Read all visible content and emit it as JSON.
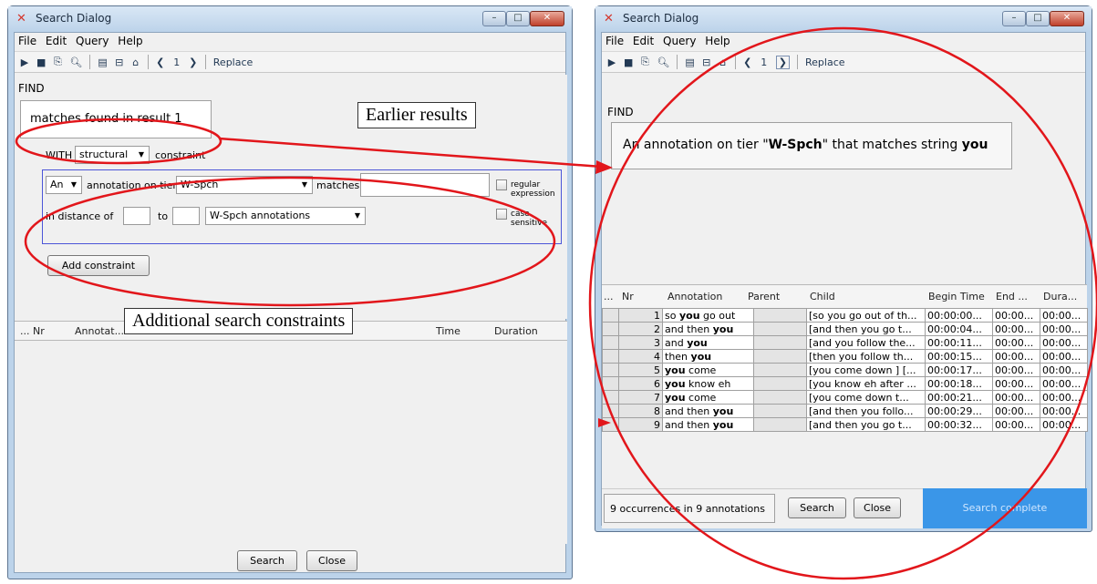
{
  "left_window": {
    "title": "Search Dialog",
    "menu": [
      "File",
      "Edit",
      "Query",
      "Help"
    ],
    "toolbar": {
      "page_indicator": "1",
      "replace_label": "Replace"
    },
    "find_label": "FIND",
    "result_ref_text": "matches found in result 1",
    "with_label": "WITH",
    "constraint_type": "structural",
    "constraint_suffix": "constraint",
    "quantifier": "An",
    "annotation_on_tier": "annotation on tier",
    "tier": "W-Spch",
    "matches_label": "matches",
    "regex_label": "regular expression",
    "in_distance_label": "in distance of",
    "to_label": "to",
    "unit": "W-Spch annotations",
    "case_label": "case sensitive",
    "add_constraint": "Add constraint",
    "columns": [
      "... Nr",
      "Annotat...",
      "Time",
      "Duration"
    ],
    "search_button": "Search",
    "close_button": "Close"
  },
  "right_window": {
    "title": "Search Dialog",
    "menu": [
      "File",
      "Edit",
      "Query",
      "Help"
    ],
    "toolbar": {
      "page_indicator": "1",
      "replace_label": "Replace"
    },
    "find_label": "FIND",
    "query": {
      "prefix": "An annotation on tier \"",
      "tier": "W-Spch",
      "middle": "\" that matches string ",
      "string": "you"
    },
    "columns": [
      "...",
      "Nr",
      "Annotation",
      "Parent",
      "Child",
      "Begin Time",
      "End ...",
      "Dura..."
    ],
    "rows": [
      {
        "nr": "1",
        "pre": "so ",
        "hit": "you",
        "post": " go out",
        "child": "[so you go out of th...",
        "begin": "00:00:00...",
        "end": "00:00...",
        "dur": "00:00..."
      },
      {
        "nr": "2",
        "pre": "and then ",
        "hit": "you",
        "post": "",
        "child": "[and then you go t...",
        "begin": "00:00:04...",
        "end": "00:00...",
        "dur": "00:00..."
      },
      {
        "nr": "3",
        "pre": "and ",
        "hit": "you",
        "post": "",
        "child": "[and you follow the...",
        "begin": "00:00:11...",
        "end": "00:00...",
        "dur": "00:00..."
      },
      {
        "nr": "4",
        "pre": "then ",
        "hit": "you",
        "post": "",
        "child": "[then you follow th...",
        "begin": "00:00:15...",
        "end": "00:00...",
        "dur": "00:00..."
      },
      {
        "nr": "5",
        "pre": "",
        "hit": "you",
        "post": " come",
        "child": "[you come down ] [...",
        "begin": "00:00:17...",
        "end": "00:00...",
        "dur": "00:00..."
      },
      {
        "nr": "6",
        "pre": "",
        "hit": "you",
        "post": " know eh",
        "child": "[you know eh after ...",
        "begin": "00:00:18...",
        "end": "00:00...",
        "dur": "00:00..."
      },
      {
        "nr": "7",
        "pre": "",
        "hit": "you",
        "post": " come",
        "child": "[you come down t...",
        "begin": "00:00:21...",
        "end": "00:00...",
        "dur": "00:00..."
      },
      {
        "nr": "8",
        "pre": "and then ",
        "hit": "you",
        "post": "",
        "child": "[and then you follo...",
        "begin": "00:00:29...",
        "end": "00:00...",
        "dur": "00:00..."
      },
      {
        "nr": "9",
        "pre": "and then ",
        "hit": "you",
        "post": "",
        "child": "[and then you go t...",
        "begin": "00:00:32...",
        "end": "00:00...",
        "dur": "00:00..."
      }
    ],
    "occurrences": "9 occurrences in 9 annotations",
    "search_button": "Search",
    "close_button": "Close",
    "status": "Search complete"
  },
  "callouts": {
    "earlier": "Earlier results",
    "additional": "Additional search constraints"
  },
  "colors": {
    "annotation_red": "#e2161b",
    "status_blue": "#3a96e8",
    "chrome": "#bcd3ea"
  }
}
